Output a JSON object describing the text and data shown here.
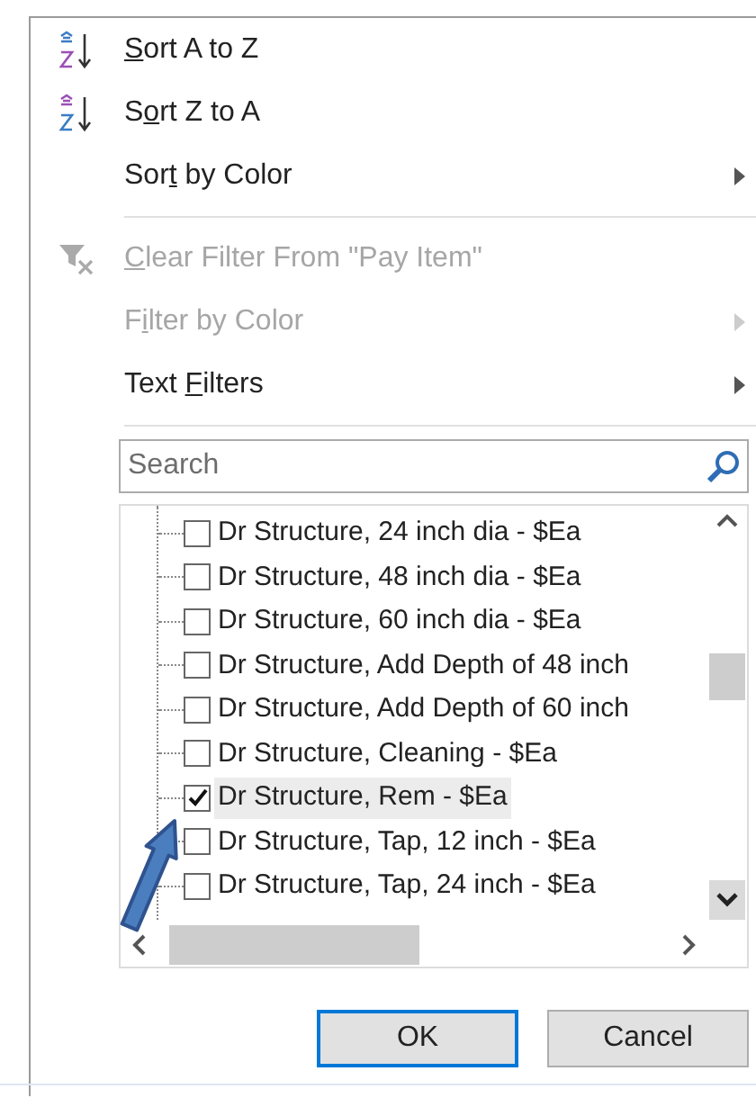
{
  "menu": [
    {
      "kind": "sort_az",
      "access_key": "S",
      "label_end": "ort A to Z",
      "disabled": false,
      "submenu": false
    },
    {
      "kind": "sort_za",
      "label_start": "S",
      "access_key": "o",
      "label_end": "rt Z to A",
      "disabled": false,
      "submenu": false
    },
    {
      "kind": "plain",
      "label_start": "Sor",
      "access_key": "t",
      "label_end": " by Color",
      "disabled": false,
      "submenu": true
    },
    {
      "kind": "separator"
    },
    {
      "kind": "clear_filter",
      "access_key": "C",
      "label_end": "lear Filter From \"Pay Item\"",
      "disabled": true,
      "submenu": false
    },
    {
      "kind": "plain",
      "label_start": "F",
      "access_key": "i",
      "label_end": "lter by Color",
      "disabled": true,
      "submenu": true
    },
    {
      "kind": "plain",
      "label_start": "Text ",
      "access_key": "F",
      "label_end": "ilters",
      "disabled": false,
      "submenu": true
    },
    {
      "kind": "separator"
    }
  ],
  "search": {
    "placeholder": "Search"
  },
  "list": [
    {
      "label": "Dr Structure, 24 inch dia - $Ea",
      "checked": false,
      "selected": false
    },
    {
      "label": "Dr Structure, 48 inch dia - $Ea",
      "checked": false,
      "selected": false
    },
    {
      "label": "Dr Structure, 60 inch dia - $Ea",
      "checked": false,
      "selected": false
    },
    {
      "label": "Dr Structure, Add Depth of 48 inch",
      "checked": false,
      "selected": false
    },
    {
      "label": "Dr Structure, Add Depth of 60 inch",
      "checked": false,
      "selected": false
    },
    {
      "label": "Dr Structure, Cleaning - $Ea",
      "checked": false,
      "selected": false
    },
    {
      "label": "Dr Structure, Rem - $Ea",
      "checked": true,
      "selected": true
    },
    {
      "label": "Dr Structure, Tap, 12 inch - $Ea",
      "checked": false,
      "selected": false
    },
    {
      "label": "Dr Structure, Tap, 24 inch - $Ea",
      "checked": false,
      "selected": false
    }
  ],
  "buttons": [
    {
      "label": "OK",
      "selected": true
    },
    {
      "label": "Cancel",
      "selected": false
    }
  ]
}
